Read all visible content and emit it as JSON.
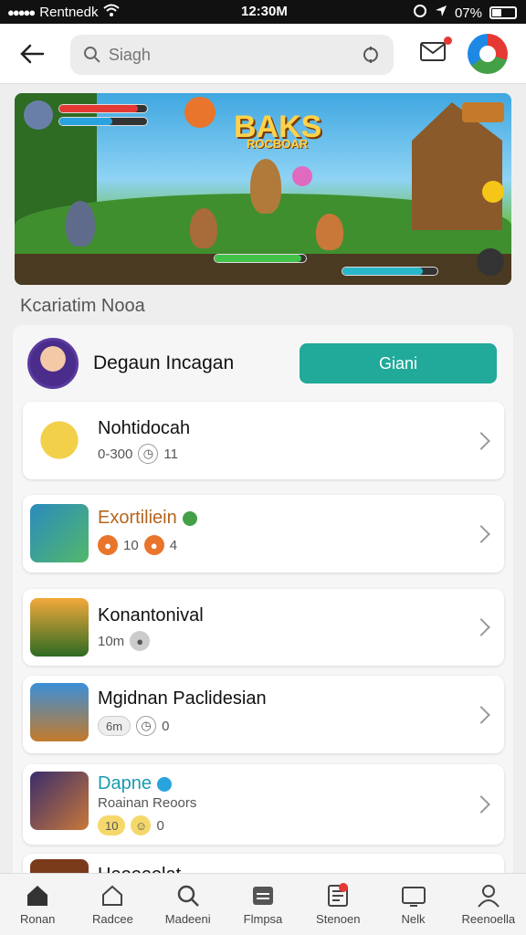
{
  "status_bar": {
    "carrier": "Rentnedk",
    "time": "12:30M",
    "battery": "07%"
  },
  "header": {
    "search_placeholder": "Siagh"
  },
  "banner": {
    "title": "BAKS",
    "subtitle": "ROCBOAR"
  },
  "section": {
    "title": "Kcariatim Nooa"
  },
  "featured": {
    "name": "Degaun Incagan",
    "button_label": "Giani"
  },
  "rows": [
    {
      "name": "Nohtidocah",
      "meta1": "0-300",
      "meta2": "11"
    },
    {
      "name": "Exortiliein",
      "meta1": "10",
      "meta2": "4"
    },
    {
      "name": "Konantonival",
      "meta1": "10m",
      "meta2": ""
    },
    {
      "name": "Mgidnan Paclidesian",
      "meta1": "6m",
      "meta2": "0"
    },
    {
      "name": "Dapne",
      "sub": "Roainan Reoors",
      "meta1": "10",
      "meta2": "0"
    },
    {
      "name": "Heooeolat"
    }
  ],
  "tabs": [
    {
      "label": "Ronan",
      "icon": "home-icon"
    },
    {
      "label": "Radcee",
      "icon": "house-outline-icon"
    },
    {
      "label": "Madeeni",
      "icon": "search-icon"
    },
    {
      "label": "Flmpsa",
      "icon": "card-icon"
    },
    {
      "label": "Stenoen",
      "icon": "document-icon"
    },
    {
      "label": "Nelk",
      "icon": "tv-icon"
    },
    {
      "label": "Reenoella",
      "icon": "person-icon"
    }
  ]
}
